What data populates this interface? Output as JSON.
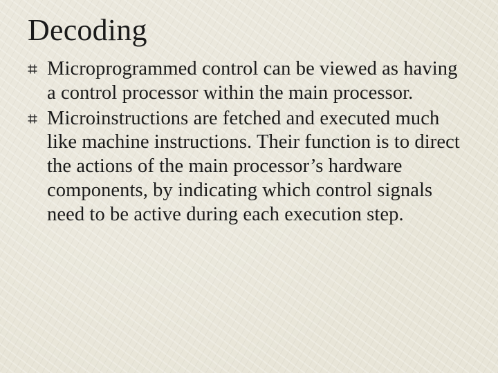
{
  "title": "Decoding",
  "bullets": [
    {
      "text": "Microprogrammed control can be viewed as having a control processor within the main processor."
    },
    {
      "text": "Microinstructions are fetched and executed much like machine instructions. Their function is to direct the actions of the main processor’s hardware components, by indicating which control signals need to be active during each execution step."
    }
  ]
}
